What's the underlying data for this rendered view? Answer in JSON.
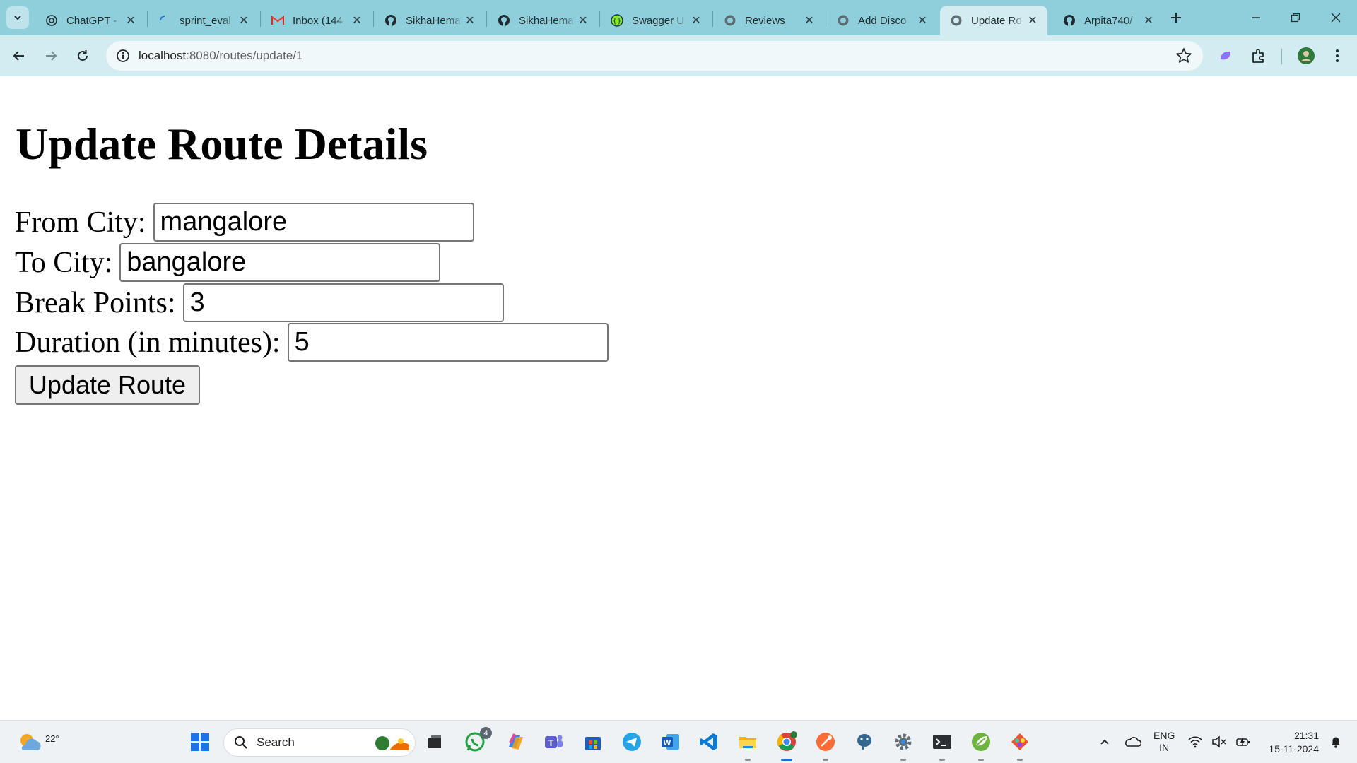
{
  "browser": {
    "tabs": [
      {
        "title": "ChatGPT -",
        "icon": "openai-icon"
      },
      {
        "title": "sprint_eval",
        "icon": "loading-icon"
      },
      {
        "title": "Inbox (144",
        "icon": "gmail-icon"
      },
      {
        "title": "SikhaHema",
        "icon": "github-icon"
      },
      {
        "title": "SikhaHema",
        "icon": "github-icon"
      },
      {
        "title": "Swagger U",
        "icon": "swagger-icon"
      },
      {
        "title": "Reviews",
        "icon": "globe-icon"
      },
      {
        "title": "Add Disco",
        "icon": "globe-icon"
      },
      {
        "title": "Update Ro",
        "icon": "globe-icon",
        "active": true
      },
      {
        "title": "Arpita740/",
        "icon": "github-icon"
      }
    ],
    "url_host": "localhost",
    "url_rest": ":8080/routes/update/1",
    "colors": {
      "tabstrip": "#8fcfdc",
      "toolbar": "#d2ecf1"
    }
  },
  "page": {
    "heading": "Update Route Details",
    "fields": {
      "from_city": {
        "label": "From City:",
        "value": "mangalore"
      },
      "to_city": {
        "label": "To City:",
        "value": "bangalore"
      },
      "break_points": {
        "label": "Break Points:",
        "value": "3"
      },
      "duration": {
        "label": "Duration (in minutes):",
        "value": "5"
      }
    },
    "submit_label": "Update Route"
  },
  "taskbar": {
    "weather_temp": "22°",
    "search_placeholder": "Search",
    "whatsapp_badge": "4",
    "lang_line1": "ENG",
    "lang_line2": "IN",
    "time": "21:31",
    "date": "15-11-2024"
  }
}
